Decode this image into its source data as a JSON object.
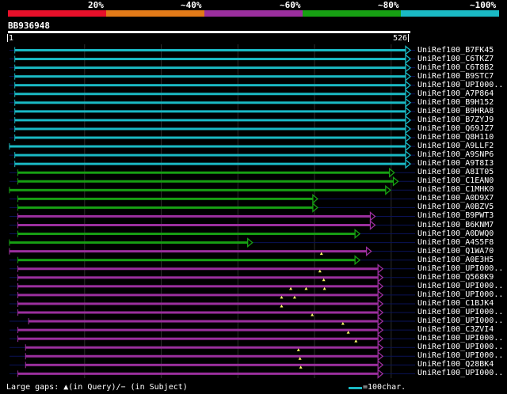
{
  "header": {
    "identity_scale": [
      {
        "label": "20%",
        "color": "#e8102a"
      },
      {
        "label": "~40%",
        "color": "#e27a18"
      },
      {
        "label": "~60%",
        "color": "#9b2f9e"
      },
      {
        "label": "~80%",
        "color": "#17a013"
      },
      {
        "label": "~100%",
        "color": "#1ab9c4"
      }
    ]
  },
  "query": {
    "id": "BB936948",
    "start_label": "1",
    "end_label": "526",
    "length": 526
  },
  "hits": [
    {
      "name": "UniRef100_B7FK45",
      "class": 5,
      "q_start": 10,
      "q_end": 526
    },
    {
      "name": "UniRef100_C6TKZ7",
      "class": 5,
      "q_start": 10,
      "q_end": 526
    },
    {
      "name": "UniRef100_C6T8B2",
      "class": 5,
      "q_start": 10,
      "q_end": 526
    },
    {
      "name": "UniRef100_B9STC7",
      "class": 5,
      "q_start": 10,
      "q_end": 526
    },
    {
      "name": "UniRef100_UPI000..",
      "class": 5,
      "q_start": 10,
      "q_end": 526
    },
    {
      "name": "UniRef100_A7P864",
      "class": 5,
      "q_start": 10,
      "q_end": 526
    },
    {
      "name": "UniRef100_B9H152",
      "class": 5,
      "q_start": 10,
      "q_end": 526
    },
    {
      "name": "UniRef100_B9HRA8",
      "class": 5,
      "q_start": 10,
      "q_end": 526
    },
    {
      "name": "UniRef100_B7ZYJ9",
      "class": 5,
      "q_start": 10,
      "q_end": 526
    },
    {
      "name": "UniRef100_Q69JZ7",
      "class": 5,
      "q_start": 10,
      "q_end": 526
    },
    {
      "name": "UniRef100_Q8H110",
      "class": 5,
      "q_start": 10,
      "q_end": 526
    },
    {
      "name": "UniRef100_A9LLF2",
      "class": 5,
      "q_start": 3,
      "q_end": 526
    },
    {
      "name": "UniRef100_A9SNP6",
      "class": 5,
      "q_start": 10,
      "q_end": 526
    },
    {
      "name": "UniRef100_A9T8I3",
      "class": 5,
      "q_start": 10,
      "q_end": 526
    },
    {
      "name": "UniRef100_A8IT05",
      "class": 4,
      "q_start": 14,
      "q_end": 505
    },
    {
      "name": "UniRef100_C1EAN0",
      "class": 4,
      "q_start": 14,
      "q_end": 510
    },
    {
      "name": "UniRef100_C1MHK0",
      "class": 4,
      "q_start": 3,
      "q_end": 500
    },
    {
      "name": "UniRef100_A0D9X7",
      "class": 4,
      "q_start": 14,
      "q_end": 405
    },
    {
      "name": "UniRef100_A0BZV5",
      "class": 4,
      "q_start": 14,
      "q_end": 405
    },
    {
      "name": "UniRef100_B9PWT3",
      "class": 3,
      "q_start": 14,
      "q_end": 480
    },
    {
      "name": "UniRef100_B6KNM7",
      "class": 3,
      "q_start": 14,
      "q_end": 480
    },
    {
      "name": "UniRef100_A0DWQ0",
      "class": 4,
      "q_start": 14,
      "q_end": 460
    },
    {
      "name": "UniRef100_A4S5F8",
      "class": 4,
      "q_start": 3,
      "q_end": 320
    },
    {
      "name": "UniRef100_Q1WA70",
      "class": 3,
      "q_start": 3,
      "q_end": 475,
      "gaps": [
        410
      ]
    },
    {
      "name": "UniRef100_A0E3H5",
      "class": 4,
      "q_start": 14,
      "q_end": 460
    },
    {
      "name": "UniRef100_UPI000..",
      "class": 3,
      "q_start": 14,
      "q_end": 490,
      "gaps": [
        408
      ]
    },
    {
      "name": "UniRef100_Q568K9",
      "class": 3,
      "q_start": 14,
      "q_end": 490,
      "gaps": [
        413
      ]
    },
    {
      "name": "UniRef100_UPI000..",
      "class": 3,
      "q_start": 14,
      "q_end": 490,
      "gaps": [
        370,
        390,
        414
      ]
    },
    {
      "name": "UniRef100_UPI000..",
      "class": 3,
      "q_start": 14,
      "q_end": 490,
      "gaps": [
        358,
        375
      ]
    },
    {
      "name": "UniRef100_C1BJK4",
      "class": 3,
      "q_start": 14,
      "q_end": 490,
      "gaps": [
        358
      ]
    },
    {
      "name": "UniRef100_UPI000..",
      "class": 3,
      "q_start": 14,
      "q_end": 490,
      "gaps": [
        398
      ]
    },
    {
      "name": "UniRef100_UPI000..",
      "class": 3,
      "q_start": 28,
      "q_end": 490,
      "gaps": [
        438
      ]
    },
    {
      "name": "UniRef100_C3ZVI4",
      "class": 3,
      "q_start": 14,
      "q_end": 490,
      "gaps": [
        445
      ]
    },
    {
      "name": "UniRef100_UPI000..",
      "class": 3,
      "q_start": 14,
      "q_end": 490,
      "gaps": [
        455
      ]
    },
    {
      "name": "UniRef100_UPI000..",
      "class": 3,
      "q_start": 24,
      "q_end": 490,
      "gaps": [
        380
      ]
    },
    {
      "name": "UniRef100_UPI000..",
      "class": 3,
      "q_start": 24,
      "q_end": 490,
      "gaps": [
        382
      ]
    },
    {
      "name": "UniRef100_Q28BK4",
      "class": 3,
      "q_start": 24,
      "q_end": 490,
      "gaps": [
        383
      ]
    },
    {
      "name": "UniRef100_UPI000..",
      "class": 3,
      "q_start": 14,
      "q_end": 490
    }
  ],
  "footer": {
    "gap_legend": "Large gaps: ▲(in Query)/− (in Subject)",
    "scale_legend": "=100char."
  }
}
